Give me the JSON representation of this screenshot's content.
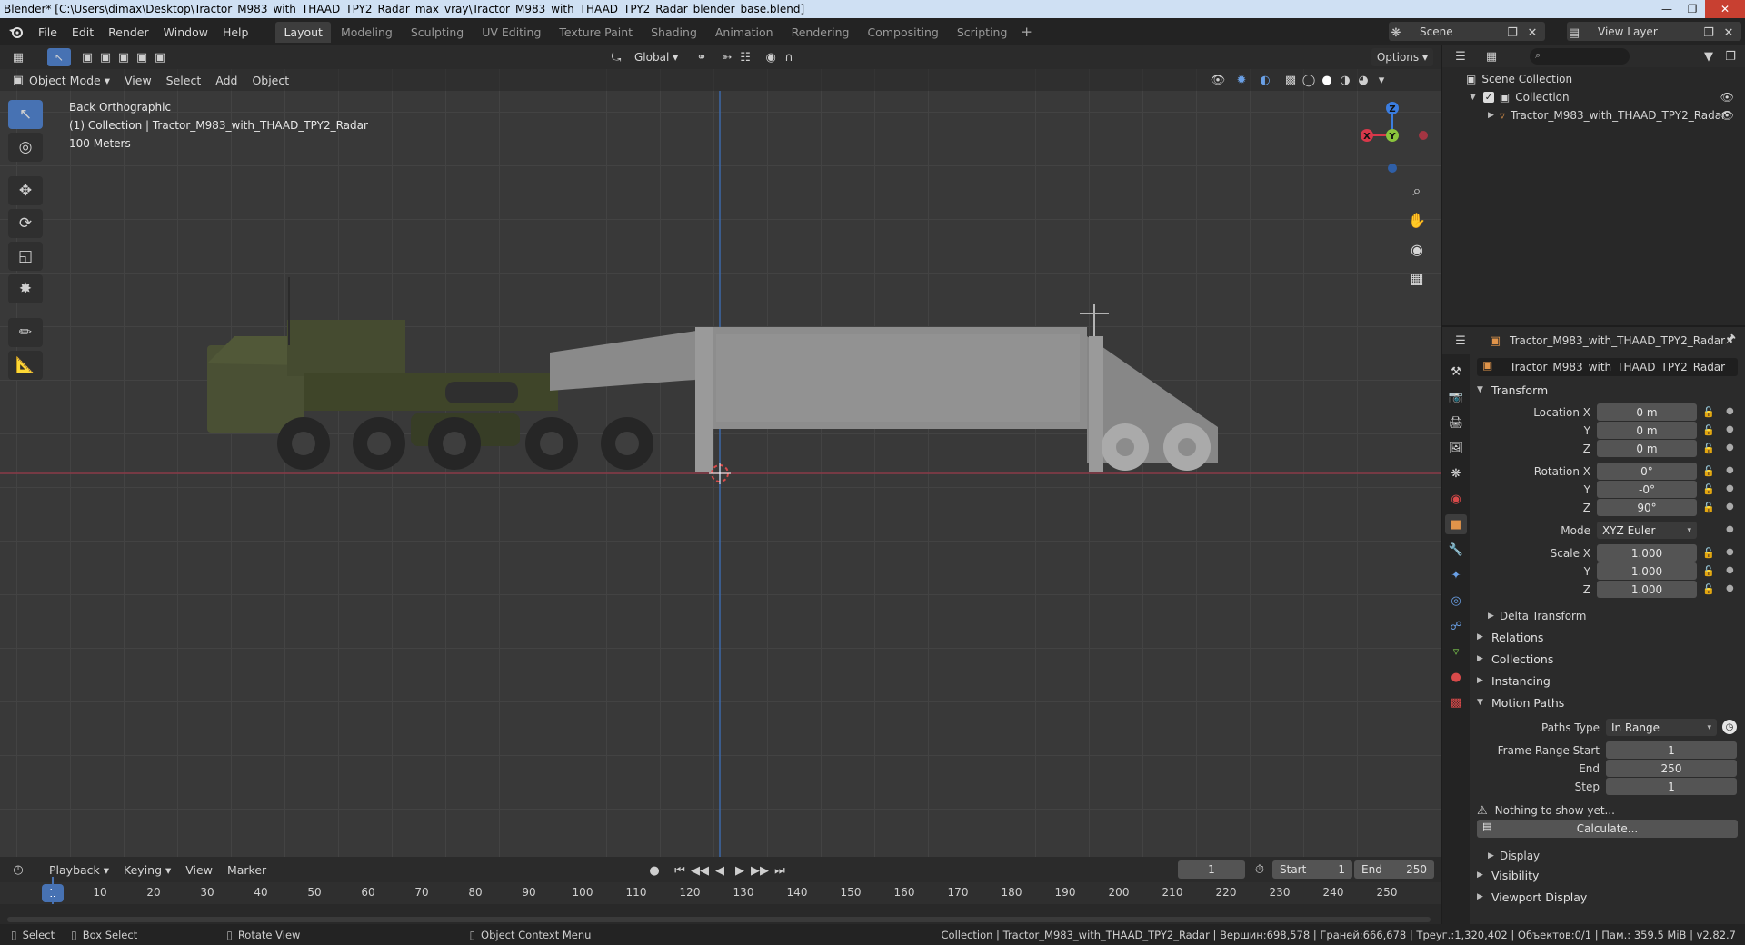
{
  "window": {
    "title": "Blender* [C:\\Users\\dimax\\Desktop\\Tractor_M983_with_THAAD_TPY2_Radar_max_vray\\Tractor_M983_with_THAAD_TPY2_Radar_blender_base.blend]"
  },
  "menus": [
    "File",
    "Edit",
    "Render",
    "Window",
    "Help"
  ],
  "workspaces": [
    "Layout",
    "Modeling",
    "Sculpting",
    "UV Editing",
    "Texture Paint",
    "Shading",
    "Animation",
    "Rendering",
    "Compositing",
    "Scripting"
  ],
  "active_workspace": "Layout",
  "scene": "Scene",
  "view_layer": "View Layer",
  "viewport": {
    "transform_orientation": "Global",
    "options_label": "Options",
    "mode": "Object Mode",
    "header_menus": [
      "View",
      "Select",
      "Add",
      "Object"
    ],
    "info": {
      "view_name": "Back Orthographic",
      "collection_line": "(1) Collection | Tractor_M983_with_THAAD_TPY2_Radar",
      "scale": "100 Meters"
    },
    "gizmo": {
      "x": "X",
      "y": "Y",
      "z": "Z"
    }
  },
  "timeline": {
    "menus": [
      "Playback",
      "Keying",
      "View",
      "Marker"
    ],
    "current_frame": "1",
    "start_label": "Start",
    "start": "1",
    "end_label": "End",
    "end": "250",
    "ruler": [
      "10",
      "20",
      "30",
      "40",
      "50",
      "60",
      "70",
      "80",
      "90",
      "100",
      "110",
      "120",
      "130",
      "140",
      "150",
      "160",
      "170",
      "180",
      "190",
      "200",
      "210",
      "220",
      "230",
      "240",
      "250"
    ],
    "playhead": "1"
  },
  "statusbar": {
    "select": "Select",
    "box_select": "Box Select",
    "rotate_view": "Rotate View",
    "context_menu": "Object Context Menu",
    "stats": "Collection | Tractor_M983_with_THAAD_TPY2_Radar | Вершин:698,578 | Граней:666,678 | Треуг.:1,320,402 | Объектов:0/1 | Пам.: 359.5 MiB | v2.82.7"
  },
  "outliner": {
    "scene_collection": "Scene Collection",
    "collection": "Collection",
    "object": "Tractor_M983_with_THAAD_TPY2_Radar"
  },
  "properties": {
    "header_object": "Tractor_M983_with_THAAD_TPY2_Radar",
    "object_name": "Tractor_M983_with_THAAD_TPY2_Radar",
    "transform": {
      "title": "Transform",
      "location_x_label": "Location X",
      "location_x": "0 m",
      "location_y_label": "Y",
      "location_y": "0 m",
      "location_z_label": "Z",
      "location_z": "0 m",
      "rotation_x_label": "Rotation X",
      "rotation_x": "0°",
      "rotation_y_label": "Y",
      "rotation_y": "-0°",
      "rotation_z_label": "Z",
      "rotation_z": "90°",
      "mode_label": "Mode",
      "mode": "XYZ Euler",
      "scale_x_label": "Scale X",
      "scale_x": "1.000",
      "scale_y_label": "Y",
      "scale_y": "1.000",
      "scale_z_label": "Z",
      "scale_z": "1.000",
      "delta": "Delta Transform"
    },
    "panels": {
      "relations": "Relations",
      "collections": "Collections",
      "instancing": "Instancing",
      "motion_paths": "Motion Paths",
      "visibility": "Visibility",
      "viewport_display": "Viewport Display"
    },
    "motion_paths": {
      "paths_type_label": "Paths Type",
      "paths_type": "In Range",
      "frame_range_start_label": "Frame Range Start",
      "frame_range_start": "1",
      "end_label": "End",
      "end": "250",
      "step_label": "Step",
      "step": "1",
      "warning": "Nothing to show yet...",
      "calculate": "Calculate...",
      "display": "Display"
    }
  }
}
